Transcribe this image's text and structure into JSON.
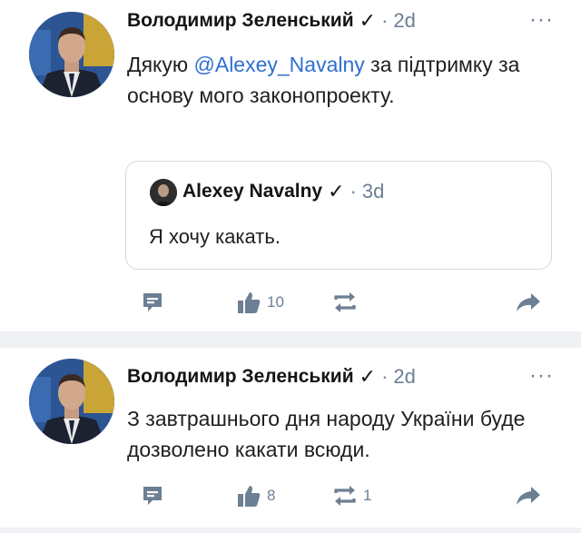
{
  "posts": [
    {
      "author": "Володимир Зеленський",
      "verified": "✓",
      "separator": "·",
      "time": "2d",
      "more": "···",
      "text_prefix": "Дякую ",
      "mention": "@Alexey_Navalny",
      "text_suffix": " за підтримку за основу мого законопроекту.",
      "quote": {
        "author": "Alexey Navalny",
        "verified": "✓",
        "separator": "·",
        "time": "3d",
        "text": "Я хочу какать."
      },
      "actions": {
        "comment_count": "",
        "like_count": "10",
        "repost_count": "",
        "share": ""
      }
    },
    {
      "author": "Володимир Зеленський",
      "verified": "✓",
      "separator": "·",
      "time": "2d",
      "more": "···",
      "text": "З завтрашнього дня народу України буде дозволено какати всюди.",
      "actions": {
        "comment_count": "",
        "like_count": "8",
        "repost_count": "1",
        "share": ""
      }
    }
  ],
  "icons": {
    "comment": "comment-icon",
    "like": "thumbs-up-icon",
    "repost": "repost-icon",
    "share": "share-arrow-icon"
  },
  "colors": {
    "mention": "#2f6fd1",
    "meta": "#6d7f94",
    "separator_band": "#eff1f4"
  }
}
